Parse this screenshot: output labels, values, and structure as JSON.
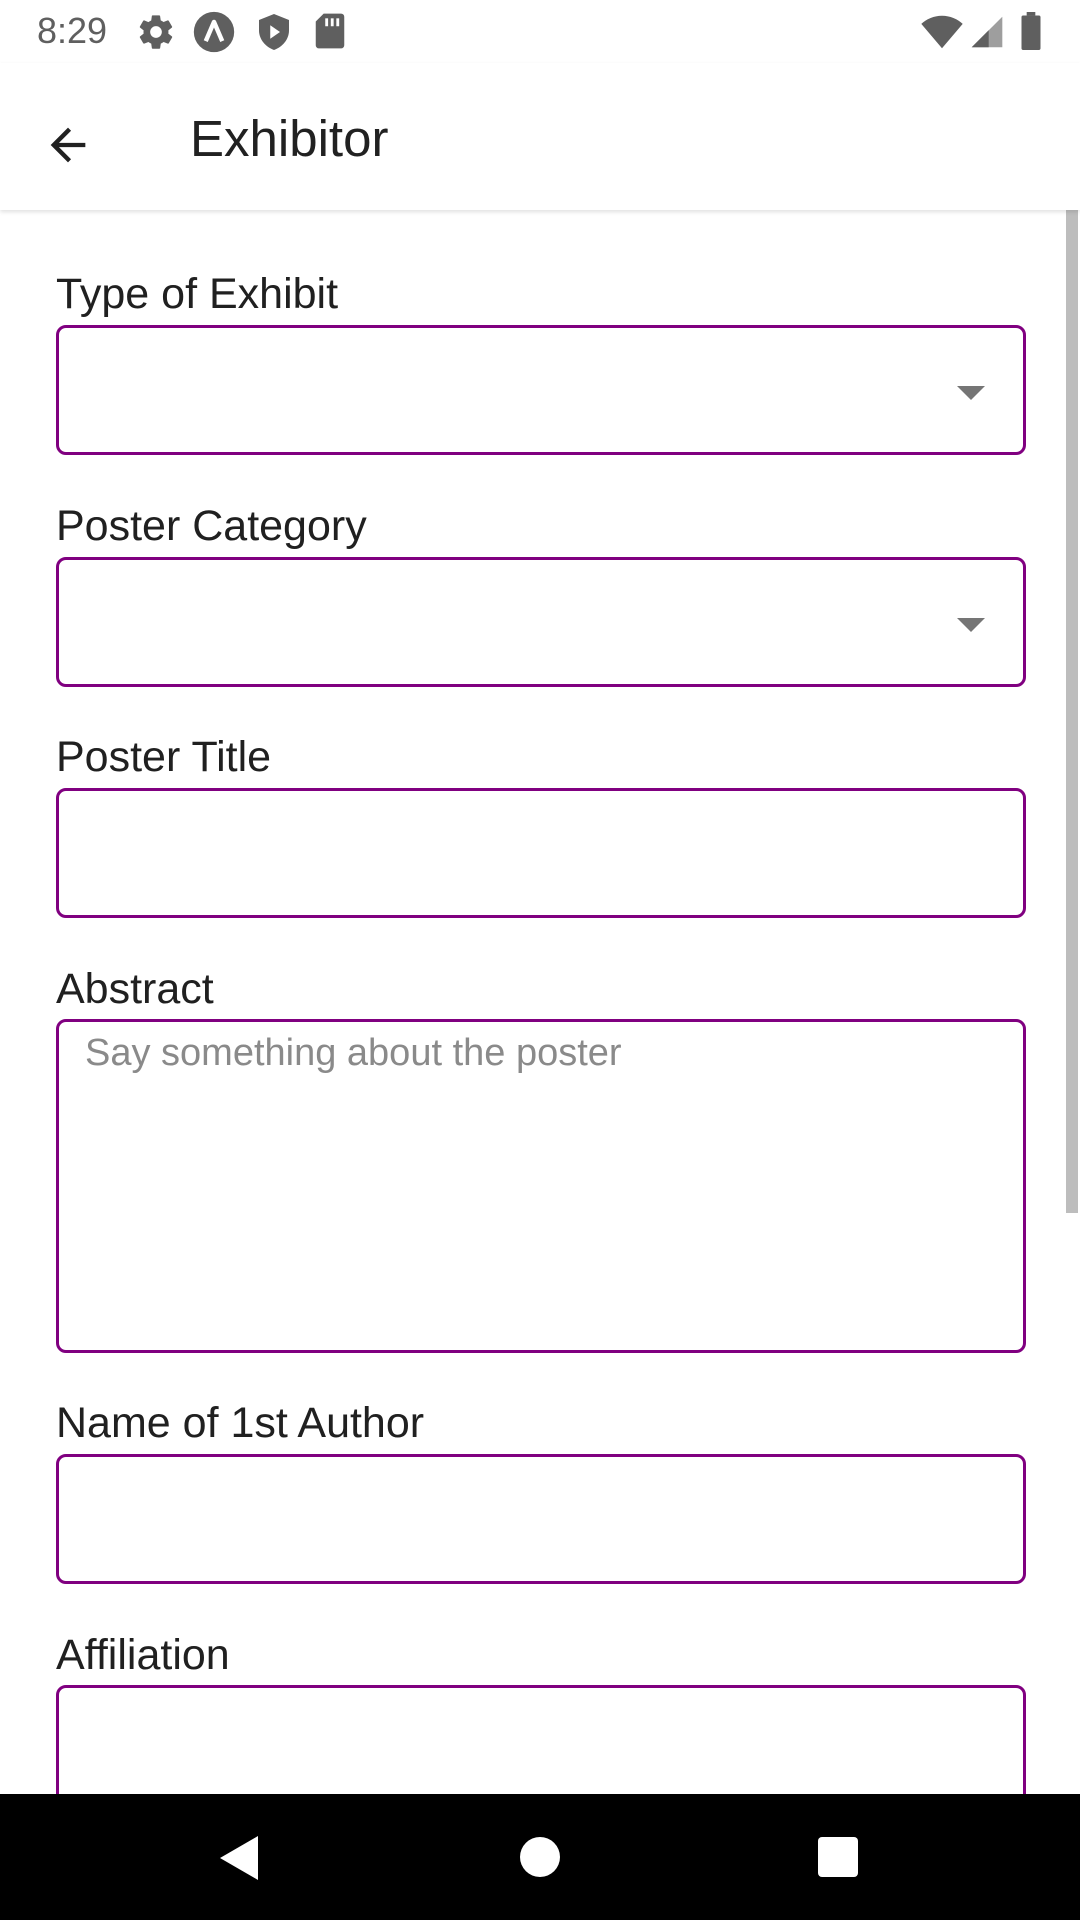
{
  "status_bar": {
    "time": "8:29",
    "left_icons": [
      "settings-icon",
      "autonomous-icon",
      "shield-play-icon",
      "sd-card-icon"
    ],
    "right_icons": [
      "wifi-icon",
      "signal-icon",
      "battery-icon"
    ]
  },
  "app_bar": {
    "title": "Exhibitor",
    "back_icon": "arrow-back-icon"
  },
  "form": {
    "type_of_exhibit": {
      "label": "Type of Exhibit",
      "value": ""
    },
    "poster_category": {
      "label": "Poster Category",
      "value": ""
    },
    "poster_title": {
      "label": "Poster Title",
      "value": ""
    },
    "abstract": {
      "label": "Abstract",
      "placeholder": "Say something about the poster",
      "value": ""
    },
    "first_author": {
      "label": "Name of 1st Author",
      "value": ""
    },
    "affiliation": {
      "label": "Affiliation",
      "value": ""
    }
  },
  "nav_bar": {
    "icons": [
      "nav-back-icon",
      "nav-home-icon",
      "nav-recents-icon"
    ]
  },
  "colors": {
    "field_border": "#800080",
    "nav_bar": "#000000"
  }
}
